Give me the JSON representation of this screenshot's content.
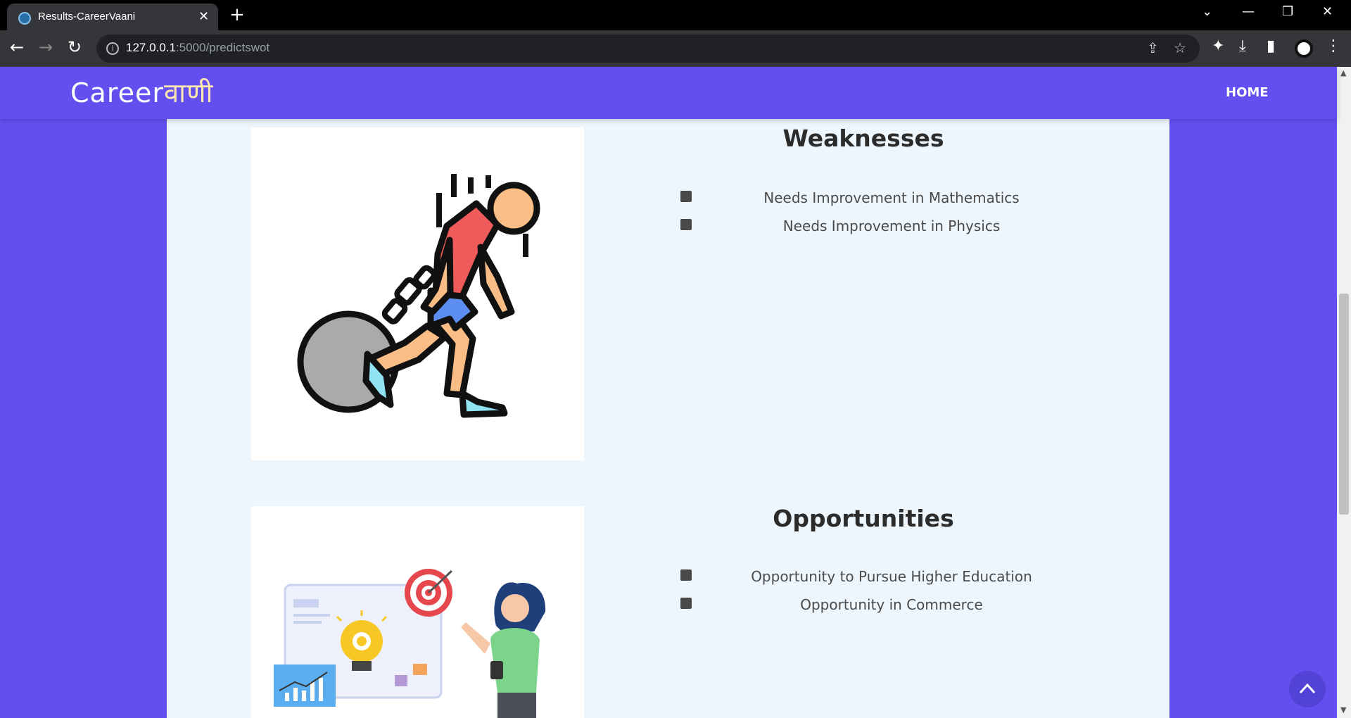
{
  "browser": {
    "tab_title": "Results-CareerVaani",
    "tab_close": "✕",
    "new_tab": "+",
    "url_host": "127.0.0.1",
    "url_path": ":5000/predictswot",
    "controls": {
      "list": "⌄",
      "minimize": "—",
      "restore": "❐",
      "close": "✕"
    }
  },
  "site": {
    "logo_main": "Career",
    "logo_accent": "वाणी",
    "nav_home": "HOME"
  },
  "sections": {
    "weaknesses": {
      "title": "Weaknesses",
      "items": [
        "Needs Improvement in Mathematics",
        "Needs Improvement in Physics"
      ]
    },
    "opportunities": {
      "title": "Opportunities",
      "items": [
        "Opportunity to Pursue Higher Education",
        "Opportunity in Commerce"
      ]
    }
  },
  "colors": {
    "brand": "#634ff0",
    "content_bg": "#eef6fd",
    "back_to_top": "#5243d6"
  },
  "icons": [
    "back-icon",
    "forward-icon",
    "reload-icon",
    "info-icon",
    "share-icon",
    "star-icon",
    "extensions-icon",
    "download-icon",
    "sidepanel-icon",
    "profile-icon",
    "menu-icon",
    "chevron-up-icon"
  ]
}
